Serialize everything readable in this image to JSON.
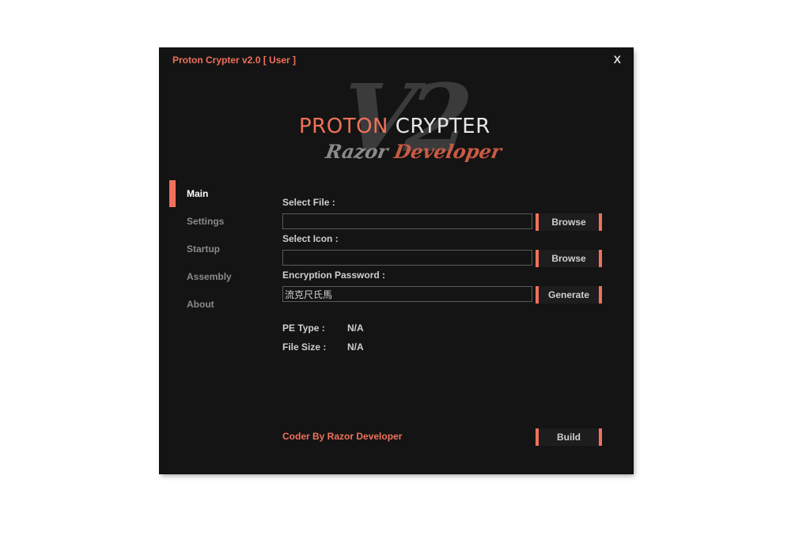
{
  "window": {
    "title": "Proton Crypter v2.0 [ User ]",
    "close_label": "X"
  },
  "logo": {
    "mark": "V2",
    "word1": "PROTON",
    "word2": "CRYPTER",
    "sub1": "Razor",
    "sub2": "Developer"
  },
  "sidebar": {
    "items": [
      {
        "label": "Main",
        "active": true
      },
      {
        "label": "Settings",
        "active": false
      },
      {
        "label": "Startup",
        "active": false
      },
      {
        "label": "Assembly",
        "active": false
      },
      {
        "label": "About",
        "active": false
      }
    ]
  },
  "form": {
    "select_file_label": "Select File :",
    "select_file_value": "",
    "browse_file_label": "Browse",
    "select_icon_label": "Select Icon :",
    "select_icon_value": "",
    "browse_icon_label": "Browse",
    "password_label": "Encryption Password :",
    "password_value": "流克尺氏馬",
    "generate_label": "Generate"
  },
  "info": {
    "pe_type_label": "PE Type :",
    "pe_type_value": "N/A",
    "file_size_label": "File Size :",
    "file_size_value": "N/A"
  },
  "footer": {
    "credit": "Coder By Razor Developer",
    "build_label": "Build"
  },
  "colors": {
    "accent": "#f0715a",
    "background": "#141414",
    "text": "#cfcfcf"
  }
}
